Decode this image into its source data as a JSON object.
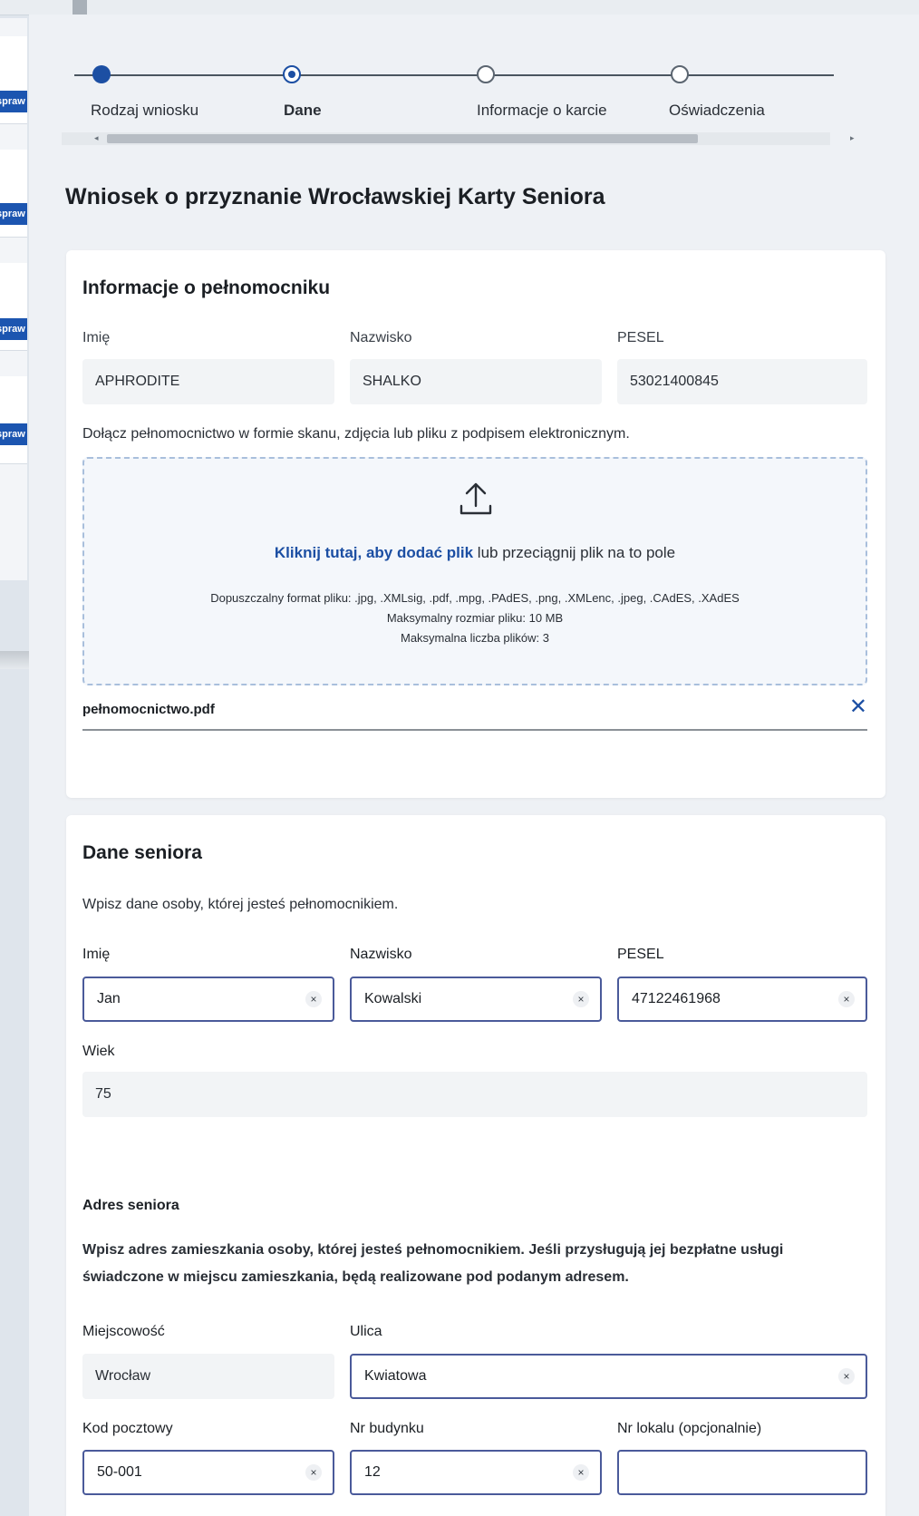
{
  "background": {
    "button_label": "spraw"
  },
  "stepper": {
    "steps": [
      {
        "label": "Rodzaj wniosku",
        "state": "done"
      },
      {
        "label": "Dane",
        "state": "current"
      },
      {
        "label": "Informacje o karcie",
        "state": "todo"
      },
      {
        "label": "Oświadczenia",
        "state": "todo"
      }
    ],
    "scroll_left": "◂",
    "scroll_right": "▸"
  },
  "page_title": "Wniosek o przyznanie Wrocławskiej Karty Seniora",
  "proxy": {
    "title": "Informacje o pełnomocniku",
    "first_name_label": "Imię",
    "first_name": "APHRODITE",
    "last_name_label": "Nazwisko",
    "last_name": "SHALKO",
    "pesel_label": "PESEL",
    "pesel": "53021400845",
    "attach_instruction": "Dołącz pełnomocnictwo w formie skanu, zdjęcia lub pliku z podpisem elektronicznym.",
    "upload": {
      "icon": "upload-icon",
      "link_text": "Kliknij tutaj, aby dodać plik",
      "rest_text": " lub przeciągnij plik na to pole",
      "formats": "Dopuszczalny format pliku: .jpg, .XMLsig, .pdf, .mpg, .PAdES, .png, .XMLenc, .jpeg, .CAdES, .XAdES",
      "max_size": "Maksymalny rozmiar pliku: 10 MB",
      "max_files": "Maksymalna liczba plików: 3"
    },
    "file_name": "pełnomocnictwo.pdf",
    "file_remove": "✕"
  },
  "senior": {
    "title": "Dane seniora",
    "instruction": "Wpisz dane osoby, której jesteś pełnomocnikiem.",
    "first_name_label": "Imię",
    "first_name": "Jan",
    "last_name_label": "Nazwisko",
    "last_name": "Kowalski",
    "pesel_label": "PESEL",
    "pesel": "47122461968",
    "age_label": "Wiek",
    "age": "75",
    "address_heading": "Adres seniora",
    "address_instruction_line1": "Wpisz adres zamieszkania osoby, której jesteś pełnomocnikiem. Jeśli przysługują jej bezpłatne usługi",
    "address_instruction_line2": "świadczone w miejscu zamieszkania, będą realizowane pod podanym adresem.",
    "city_label": "Miejscowość",
    "city": "Wrocław",
    "street_label": "Ulica",
    "street": "Kwiatowa",
    "postal_label": "Kod pocztowy",
    "postal": "50-001",
    "building_label": "Nr budynku",
    "building": "12",
    "apartment_label": "Nr lokalu (opcjonalnie)",
    "apartment": "",
    "clear_glyph": "×"
  },
  "colors": {
    "accent": "#1c4fa3",
    "input_border": "#4a5a9a",
    "panel_bg": "#eef1f5"
  }
}
